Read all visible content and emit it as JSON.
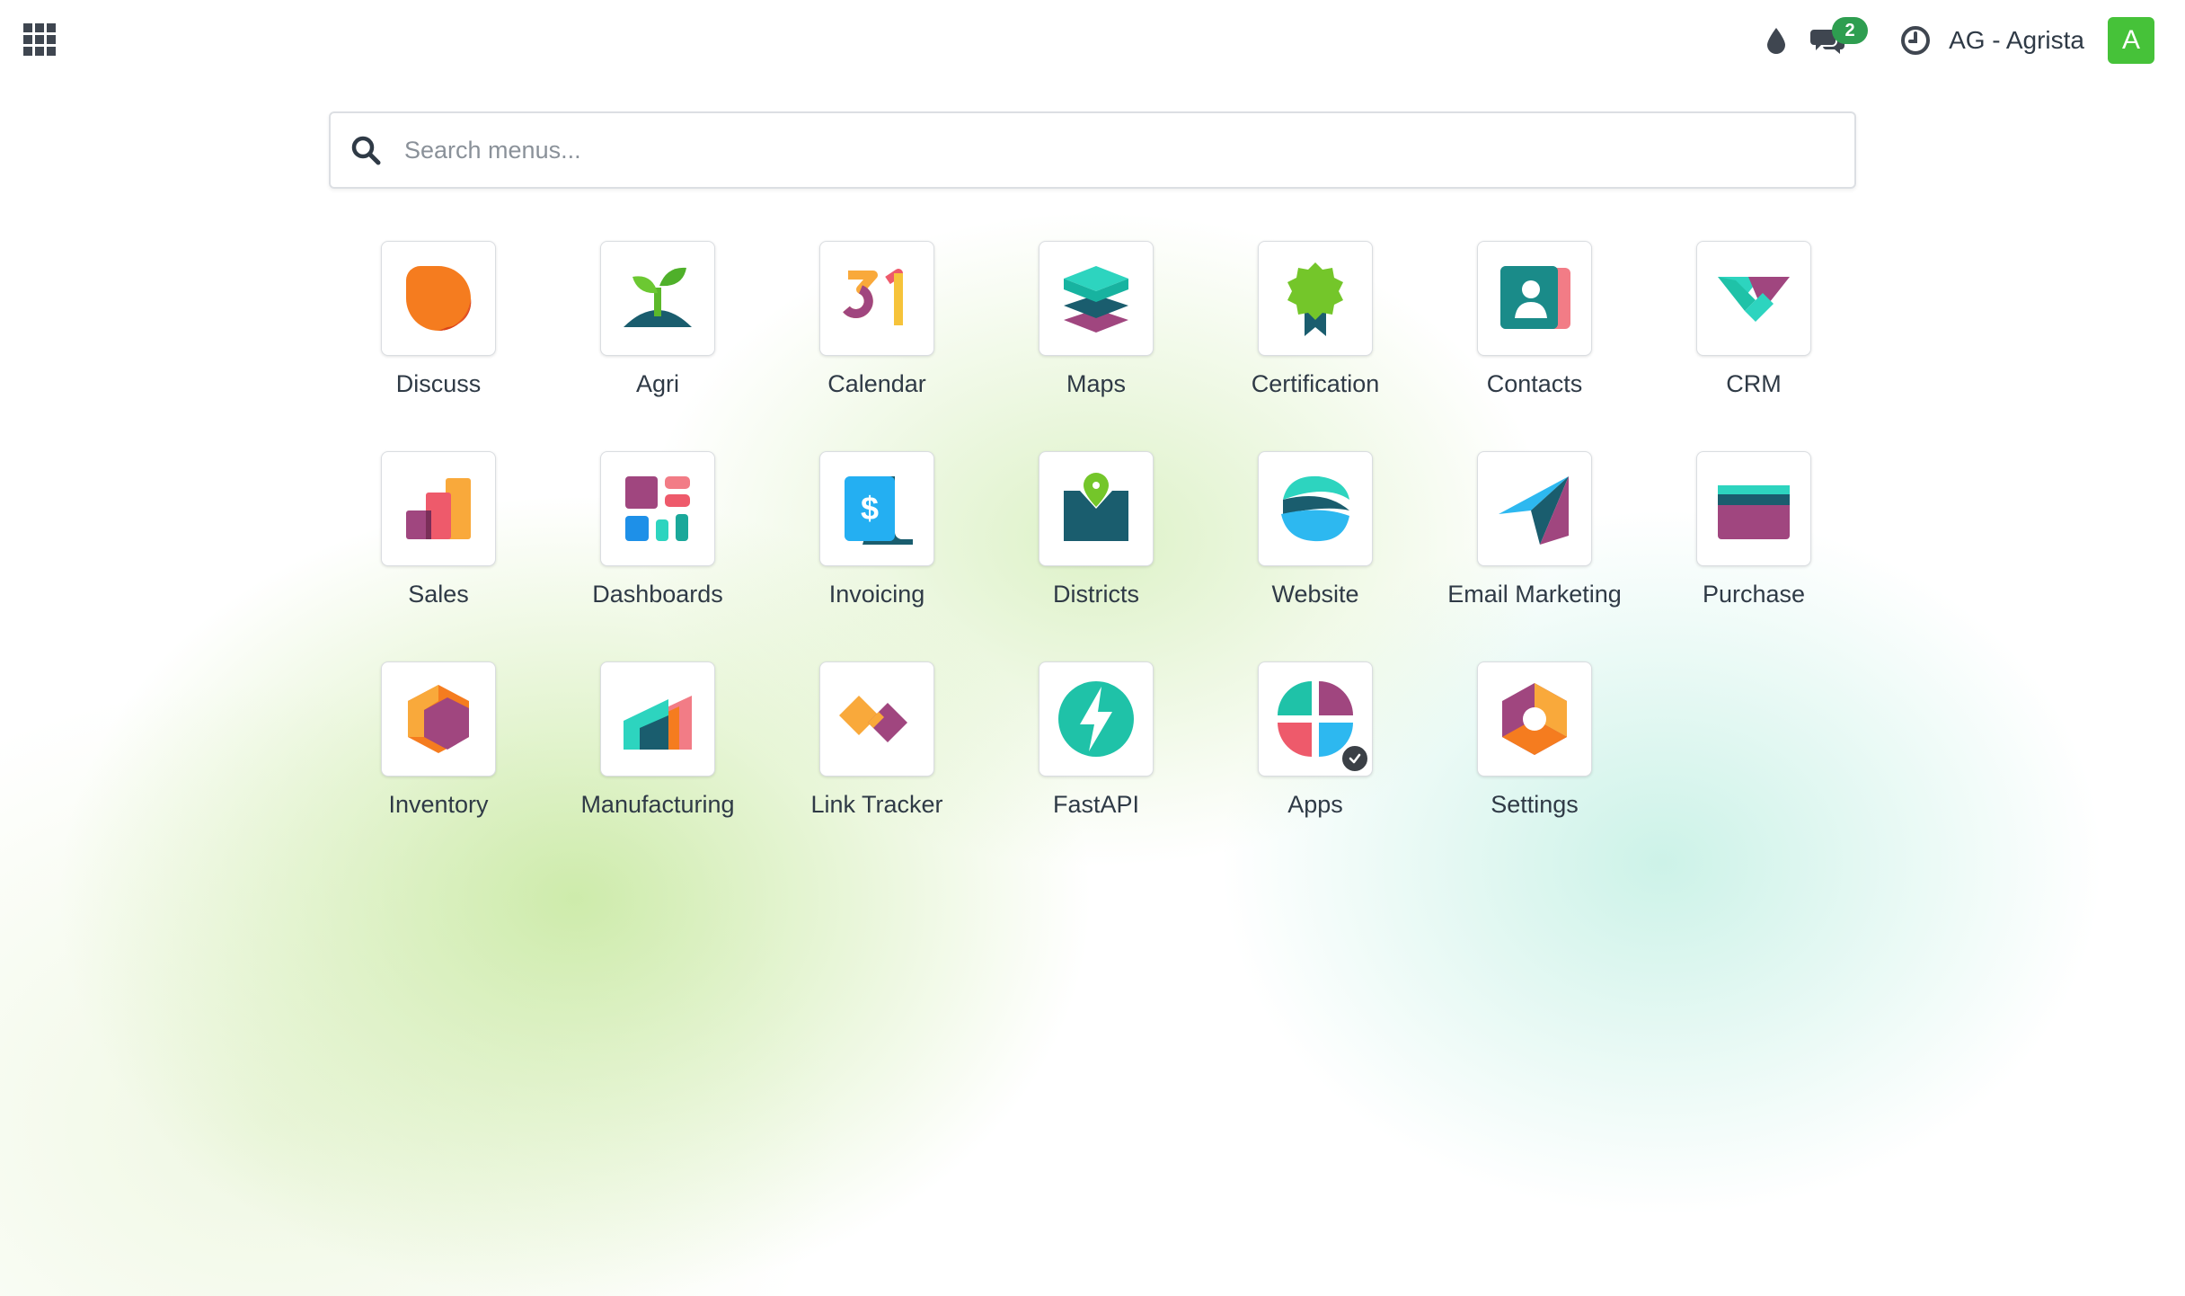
{
  "topbar": {
    "apps_menu_icon": "grid-icon",
    "status_icon": "drop-icon",
    "messages_icon": "chat-icon",
    "messages_count": "2",
    "activity_icon": "clock-icon",
    "company_name": "AG - Agrista",
    "user_initial": "A",
    "avatar_color": "#46c239",
    "badge_color": "#2e9e50"
  },
  "search": {
    "placeholder": "Search menus..."
  },
  "apps": [
    {
      "label": "Discuss",
      "icon": "discuss-icon"
    },
    {
      "label": "Agri",
      "icon": "agri-sprout-icon"
    },
    {
      "label": "Calendar",
      "icon": "calendar-icon"
    },
    {
      "label": "Maps",
      "icon": "maps-layers-icon"
    },
    {
      "label": "Certification",
      "icon": "certification-badge-icon"
    },
    {
      "label": "Contacts",
      "icon": "contacts-card-icon"
    },
    {
      "label": "CRM",
      "icon": "crm-handshake-icon"
    },
    {
      "label": "Sales",
      "icon": "sales-chart-icon"
    },
    {
      "label": "Dashboards",
      "icon": "dashboards-icon"
    },
    {
      "label": "Invoicing",
      "icon": "invoicing-icon"
    },
    {
      "label": "Districts",
      "icon": "districts-pin-icon"
    },
    {
      "label": "Website",
      "icon": "website-globe-icon"
    },
    {
      "label": "Email Marketing",
      "icon": "email-marketing-plane-icon"
    },
    {
      "label": "Purchase",
      "icon": "purchase-card-icon"
    },
    {
      "label": "Inventory",
      "icon": "inventory-box-icon"
    },
    {
      "label": "Manufacturing",
      "icon": "manufacturing-factory-icon"
    },
    {
      "label": "Link Tracker",
      "icon": "link-tracker-icon"
    },
    {
      "label": "FastAPI",
      "icon": "fastapi-bolt-icon"
    },
    {
      "label": "Apps",
      "icon": "apps-quadrant-icon"
    },
    {
      "label": "Settings",
      "icon": "settings-hexagon-icon"
    }
  ]
}
